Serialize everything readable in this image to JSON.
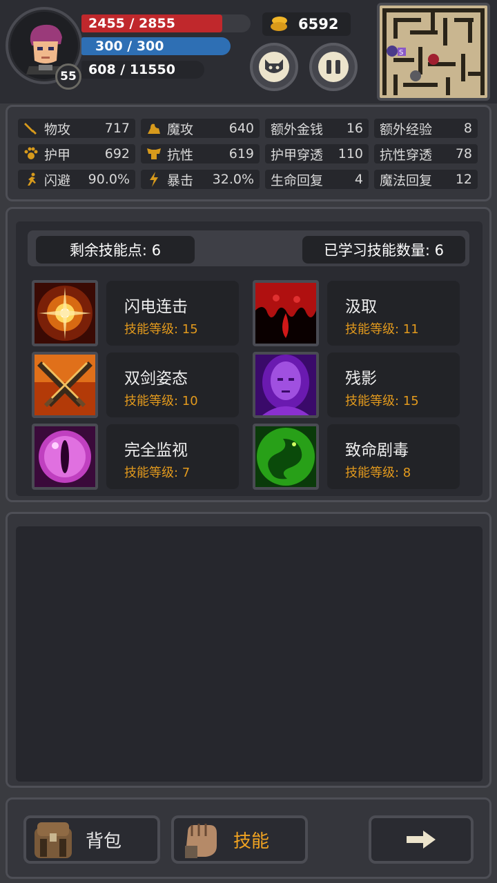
{
  "hud": {
    "hp_text": "2455 / 2855",
    "mp_text": "300 / 300",
    "xp_text": "608 / 11550",
    "level": "55",
    "gold": "6592",
    "hp_fraction": 0.86,
    "avatar_icon": "hero-portrait",
    "monster_button_icon": "monster-face-icon",
    "pause_button_icon": "pause-icon",
    "minimap_marker_label": "S"
  },
  "stats": {
    "row1": [
      {
        "icon": "sword-icon",
        "name": "物攻",
        "value": "717"
      },
      {
        "icon": "magic-hand-icon",
        "name": "魔攻",
        "value": "640"
      },
      {
        "icon": "",
        "name": "额外金钱",
        "value": "16"
      },
      {
        "icon": "",
        "name": "额外经验",
        "value": "8"
      }
    ],
    "row2": [
      {
        "icon": "paw-icon",
        "name": "护甲",
        "value": "692"
      },
      {
        "icon": "armor-icon",
        "name": "抗性",
        "value": "619"
      },
      {
        "icon": "",
        "name": "护甲穿透",
        "value": "110"
      },
      {
        "icon": "",
        "name": "抗性穿透",
        "value": "78"
      }
    ],
    "row3": [
      {
        "icon": "running-man-icon",
        "name": "闪避",
        "value": "90.0%"
      },
      {
        "icon": "lightning-icon",
        "name": "暴击",
        "value": "32.0%"
      },
      {
        "icon": "",
        "name": "生命回复",
        "value": "4"
      },
      {
        "icon": "",
        "name": "魔法回复",
        "value": "12"
      }
    ]
  },
  "skills_header": {
    "remaining_points": "剩余技能点: 6",
    "learned_count": "已学习技能数量: 6"
  },
  "skills": [
    {
      "name": "闪电连击",
      "level": "技能等级: 15",
      "icon": "spark-burst-icon"
    },
    {
      "name": "汲取",
      "level": "技能等级: 11",
      "icon": "blood-drip-icon"
    },
    {
      "name": "双剑姿态",
      "level": "技能等级: 10",
      "icon": "crossed-swords-icon"
    },
    {
      "name": "残影",
      "level": "技能等级: 15",
      "icon": "purple-face-icon"
    },
    {
      "name": "完全监视",
      "level": "技能等级: 7",
      "icon": "eye-icon"
    },
    {
      "name": "致命剧毒",
      "level": "技能等级: 8",
      "icon": "green-serpent-icon"
    }
  ],
  "bottom_nav": {
    "bag_label": "背包",
    "skill_label": "技能",
    "next_icon": "arrow-right-icon"
  },
  "colors": {
    "hp": "#c0282c",
    "mp": "#2e6fb4",
    "accent": "#e39a1d",
    "panel": "#35363c"
  }
}
